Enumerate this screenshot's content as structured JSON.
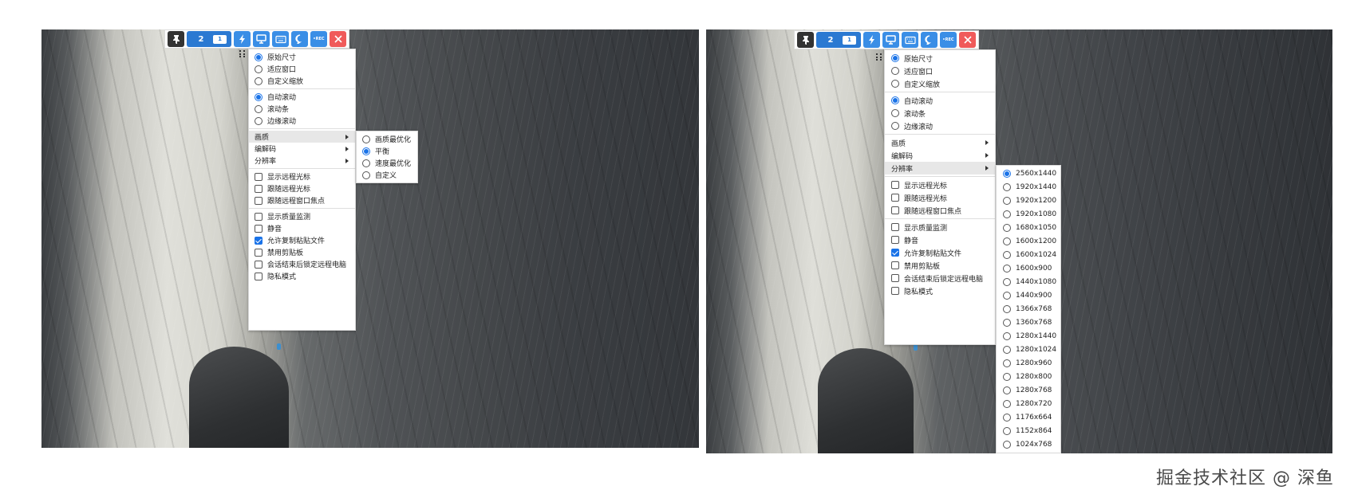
{
  "toolbar": {
    "monitor_main": "2",
    "monitor_sub": "1",
    "rec_label": "•REC",
    "icons": [
      "pin-icon",
      "lightning-icon",
      "monitor-icon",
      "keyboard-icon",
      "chat-icon",
      "rec-icon",
      "close-icon"
    ]
  },
  "main_menu": {
    "scale": [
      "原始尺寸",
      "适应窗口",
      "自定义缩放"
    ],
    "scale_selected": 0,
    "scroll": [
      "自动滚动",
      "滚动条",
      "边缘滚动"
    ],
    "scroll_selected": 0,
    "submenus": [
      "画质",
      "编解码",
      "分辨率"
    ],
    "cursor": [
      {
        "label": "显示远程光标",
        "checked": false
      },
      {
        "label": "跟随远程光标",
        "checked": false
      },
      {
        "label": "跟随远程窗口焦点",
        "checked": false
      }
    ],
    "options": [
      {
        "label": "显示质量监测",
        "checked": false
      },
      {
        "label": "静音",
        "checked": false
      },
      {
        "label": "允许复制粘贴文件",
        "checked": true
      },
      {
        "label": "禁用剪贴板",
        "checked": false
      },
      {
        "label": "会话结束后锁定远程电脑",
        "checked": false
      },
      {
        "label": "隐私模式",
        "checked": false
      }
    ]
  },
  "quality_menu": {
    "items": [
      "画质最优化",
      "平衡",
      "速度最优化",
      "自定义"
    ],
    "selected": 1
  },
  "resolution_menu": {
    "items": [
      "2560x1440",
      "1920x1440",
      "1920x1200",
      "1920x1080",
      "1680x1050",
      "1600x1200",
      "1600x1024",
      "1600x900",
      "1440x1080",
      "1440x900",
      "1366x768",
      "1360x768",
      "1280x1440",
      "1280x1024",
      "1280x960",
      "1280x800",
      "1280x768",
      "1280x720",
      "1176x664",
      "1152x864",
      "1024x768"
    ],
    "selected": 0
  },
  "watermark": "掘金技术社区 @ 深鱼",
  "colors": {
    "accent": "#1a73e8",
    "toolbar_blue": "#3a8ee6",
    "close_red": "#f05a5a"
  }
}
